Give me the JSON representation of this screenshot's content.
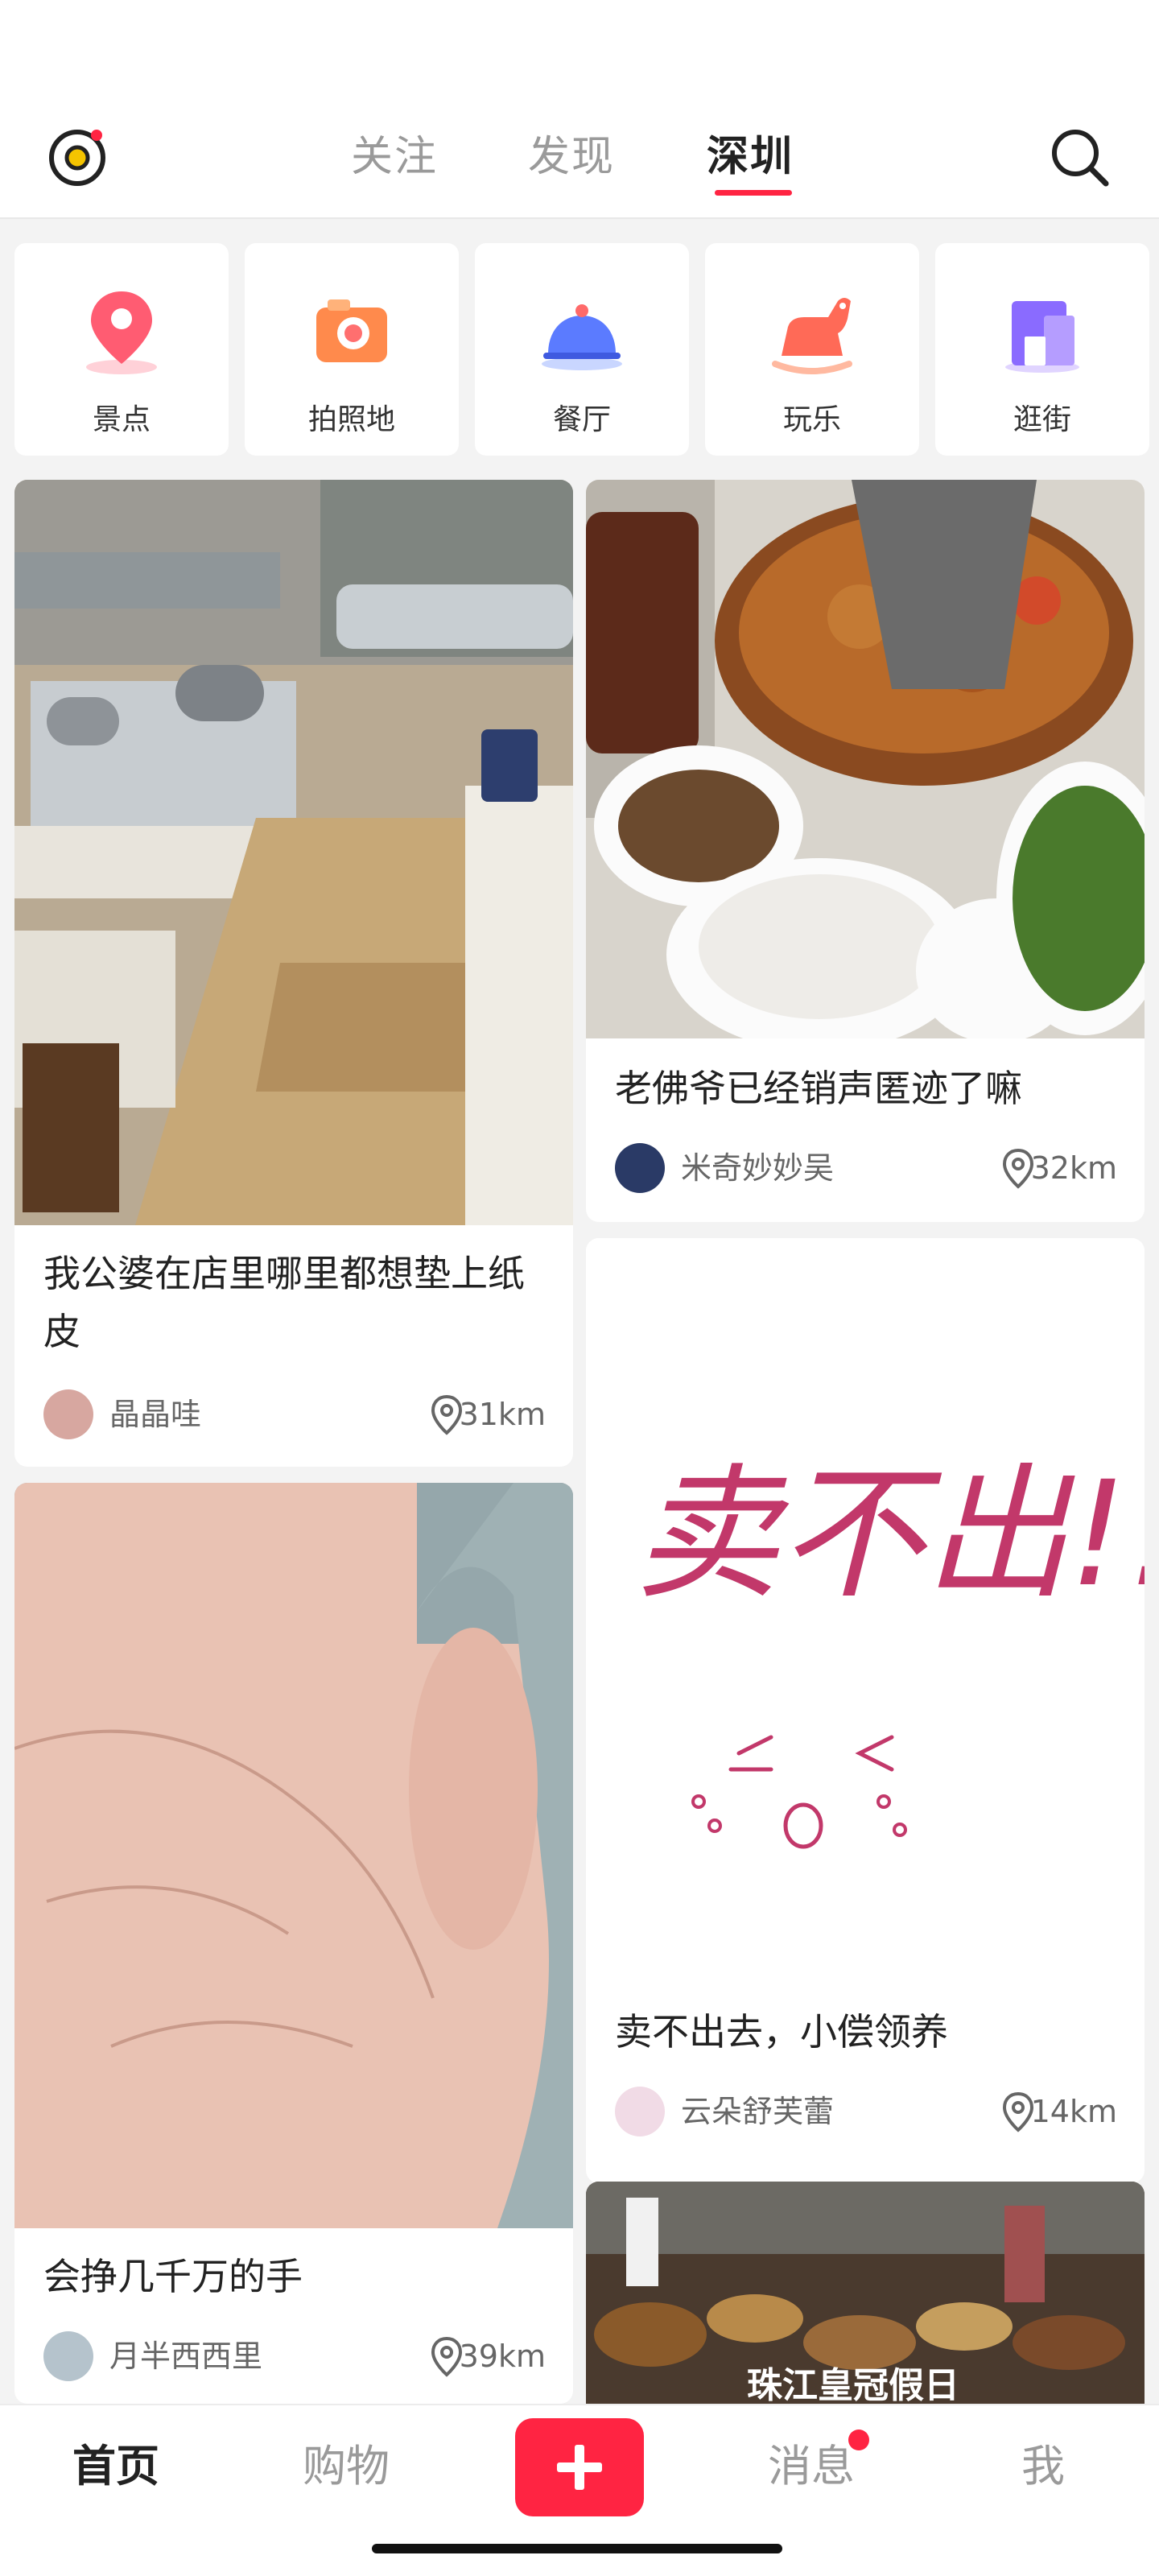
{
  "header": {
    "tabs": [
      {
        "label": "关注",
        "active": false
      },
      {
        "label": "发现",
        "active": false
      },
      {
        "label": "深圳",
        "active": true
      }
    ],
    "accent_color": "#ff2442"
  },
  "categories": [
    {
      "label": "景点",
      "icon": "map-pin-icon"
    },
    {
      "label": "拍照地",
      "icon": "camera-icon"
    },
    {
      "label": "餐厅",
      "icon": "dish-cloche-icon"
    },
    {
      "label": "玩乐",
      "icon": "rocking-horse-icon"
    },
    {
      "label": "逛街",
      "icon": "shop-building-icon"
    }
  ],
  "feed": [
    {
      "title": "我公婆在店里哪里都想垫上纸皮",
      "author": "晶晶哇",
      "distance": "31km",
      "image": "restaurant-kitchen-photo"
    },
    {
      "title": "老佛爷已经销声匿迹了嘛",
      "author": "米奇妙妙吴",
      "distance": "32km",
      "image": "hotpot-dishes-photo"
    },
    {
      "title": "卖不出去，小偿领养",
      "author": "云朵舒芙蕾",
      "distance": "14km",
      "image": "handwritten-note-image",
      "handwriting": "卖不出!!"
    },
    {
      "title": "会挣几千万的手",
      "author": "月半西西里",
      "distance": "39km",
      "image": "palm-hand-photo"
    },
    {
      "title": "",
      "author": "",
      "distance": "",
      "image": "buffet-restaurant-photo",
      "overlay_text": "珠江皇冠假日"
    }
  ],
  "bottom_nav": {
    "items": [
      {
        "label": "首页",
        "active": true
      },
      {
        "label": "购物",
        "active": false
      },
      {
        "label": "消息",
        "active": false,
        "badge": true
      },
      {
        "label": "我",
        "active": false
      }
    ],
    "add_icon": "plus-icon"
  }
}
